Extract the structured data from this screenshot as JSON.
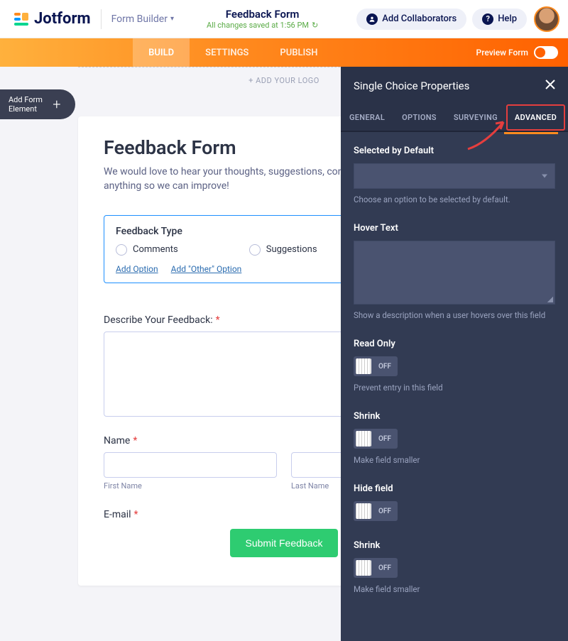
{
  "brand": "Jotform",
  "crumb": "Form Builder",
  "form_name": "Feedback Form",
  "save_status": "All changes saved at 1:56 PM",
  "header": {
    "collaborators": "Add Collaborators",
    "help": "Help"
  },
  "tabs": {
    "build": "BUILD",
    "settings": "SETTINGS",
    "publish": "PUBLISH",
    "preview": "Preview Form"
  },
  "canvas": {
    "add_element": "Add Form\nElement",
    "add_logo": "+ ADD YOUR LOGO",
    "title": "Feedback Form",
    "desc": "We would love to hear your thoughts, suggestions, concerns or problems with anything so we can improve!",
    "feedback_type": {
      "label": "Feedback Type",
      "opt1": "Comments",
      "opt2": "Suggestions",
      "add_option": "Add Option",
      "add_other": "Add \"Other\" Option"
    },
    "describe": {
      "label": "Describe Your Feedback:"
    },
    "name": {
      "label": "Name",
      "first": "First Name",
      "last": "Last Name"
    },
    "email": {
      "label": "E-mail"
    },
    "submit": "Submit Feedback"
  },
  "panel": {
    "title": "Single Choice Properties",
    "tabs": {
      "general": "GENERAL",
      "options": "OPTIONS",
      "surveying": "SURVEYING",
      "advanced": "ADVANCED"
    },
    "selected": {
      "label": "Selected by Default",
      "hint": "Choose an option to be selected by default."
    },
    "hover": {
      "label": "Hover Text",
      "hint": "Show a description when a user hovers over this field"
    },
    "readonly": {
      "label": "Read Only",
      "state": "OFF",
      "hint": "Prevent entry in this field"
    },
    "shrink1": {
      "label": "Shrink",
      "state": "OFF",
      "hint": "Make field smaller"
    },
    "hide": {
      "label": "Hide field",
      "state": "OFF"
    },
    "shrink2": {
      "label": "Shrink",
      "state": "OFF",
      "hint": "Make field smaller"
    }
  }
}
